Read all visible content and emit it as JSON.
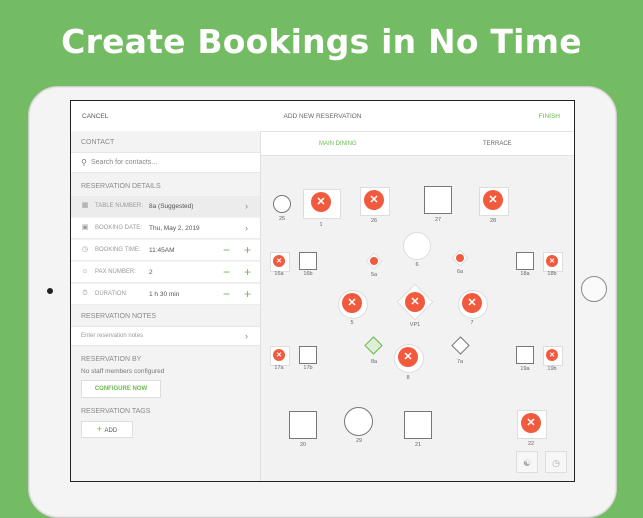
{
  "headline": "Create Bookings in No Time",
  "nav": {
    "cancel": "CANCEL",
    "title": "ADD NEW RESERVATION",
    "finish": "FINISH"
  },
  "contact": {
    "heading": "CONTACT",
    "search_placeholder": "Search for contacts..."
  },
  "details": {
    "heading": "RESERVATION DETAILS",
    "table_number": {
      "label": "TABLE NUMBER:",
      "value": "8a (Suggested)"
    },
    "booking_date": {
      "label": "BOOKING DATE:",
      "value": "Thu, May 2, 2019"
    },
    "booking_time": {
      "label": "BOOKING TIME:",
      "value": "11:45AM"
    },
    "pax": {
      "label": "PAX NUMBER:",
      "value": "2"
    },
    "duration": {
      "label": "DURATION:",
      "value": "1 h 30 min"
    }
  },
  "notes": {
    "heading": "RESERVATION NOTES",
    "placeholder": "Enter reservation notes"
  },
  "by": {
    "heading": "RESERVATION BY",
    "status": "No staff members configured",
    "configure": "CONFIGURE NOW"
  },
  "tags": {
    "heading": "RESERVATION TAGS",
    "add": "ADD"
  },
  "tabs": {
    "main": "MAIN DINING",
    "terrace": "TERRACE"
  },
  "tables": {
    "t25": "25",
    "t1": "1",
    "t26": "26",
    "t27": "27",
    "t28": "28",
    "t16a": "16a",
    "t16b": "16b",
    "t5a": "5a",
    "t6": "6",
    "t6a": "6a",
    "t18a": "18a",
    "t18b": "18b",
    "t5": "5",
    "tVP1": "VP1",
    "t7": "7",
    "t17a": "17a",
    "t17b": "17b",
    "t8a": "8a",
    "t8": "8",
    "t7a": "7a",
    "t19a": "19a",
    "t19b": "19b",
    "t20": "20",
    "t29": "29",
    "t21": "21",
    "t22": "22"
  },
  "colors": {
    "accent": "#6cb84f",
    "reserved": "#f15a3c",
    "background": "#74bc63"
  },
  "icons": {
    "reserved": "fork-knife-icon",
    "search": "search-icon"
  }
}
